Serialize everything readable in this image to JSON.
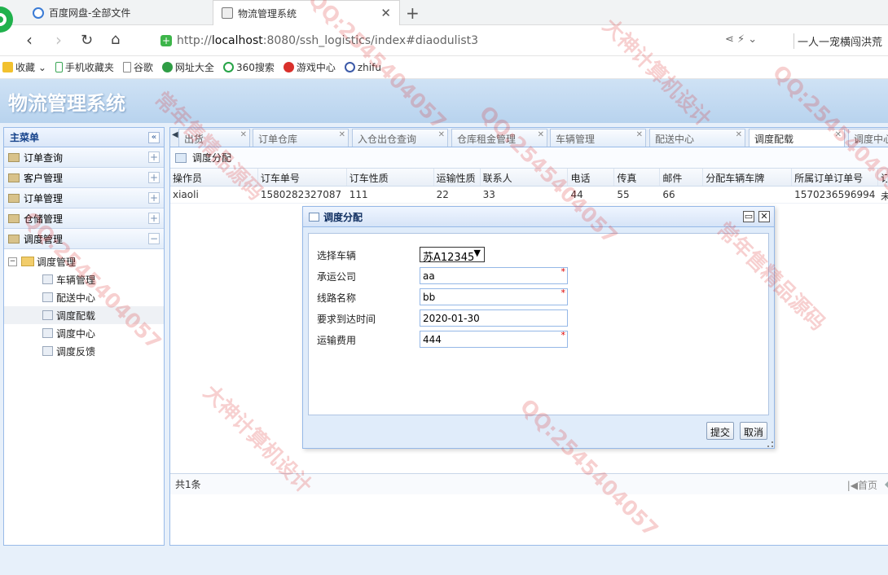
{
  "browser": {
    "tabs": [
      {
        "title": "百度网盘-全部文件"
      },
      {
        "title": "物流管理系统"
      }
    ],
    "url_prefix": "http://",
    "url_host": "localhost",
    "url_rest": ":8080/ssh_logistics/index#diaodulist3",
    "news_text": "一人一宠横闯洪荒",
    "bookmarks": [
      "收藏",
      "手机收藏夹",
      "谷歌",
      "网址大全",
      "360搜索",
      "游戏中心",
      "zhifu"
    ]
  },
  "app": {
    "title": "物流管理系统"
  },
  "sidebar": {
    "title": "主菜单",
    "menus": [
      "订单查询",
      "客户管理",
      "订单管理",
      "仓储管理",
      "调度管理"
    ],
    "tree_root": "调度管理",
    "tree_items": [
      "车辆管理",
      "配送中心",
      "调度配载",
      "调度中心",
      "调度反馈"
    ]
  },
  "main_tabs": [
    "出货",
    "订单仓库",
    "入仓出仓查询",
    "仓库租金管理",
    "车辆管理",
    "配送中心",
    "调度配载",
    "调度中心"
  ],
  "subpanel_title": "调度分配",
  "grid": {
    "columns": [
      "操作员",
      "订车单号",
      "订车性质",
      "运输性质",
      "联系人",
      "电话",
      "传真",
      "邮件",
      "分配车辆车牌",
      "所属订单订单号",
      "订"
    ],
    "rows": [
      [
        "xiaoli",
        "1580282327087",
        "111",
        "22",
        "33",
        "44",
        "55",
        "66",
        "",
        "1570236596994",
        "未"
      ]
    ]
  },
  "pager": {
    "total": "共1条",
    "first": "首页"
  },
  "dialog": {
    "title": "调度分配",
    "fields": [
      {
        "label": "选择车辆",
        "value": "苏A12345"
      },
      {
        "label": "承运公司",
        "value": "aa"
      },
      {
        "label": "线路名称",
        "value": "bb"
      },
      {
        "label": "要求到达时间",
        "value": "2020-01-30"
      },
      {
        "label": "运输费用",
        "value": "444"
      }
    ],
    "required_mark": "*",
    "submit": "提交",
    "cancel": "取消"
  },
  "watermark": [
    "QQ:2545404057",
    "大神计算机设计",
    "常年售精品源码"
  ]
}
